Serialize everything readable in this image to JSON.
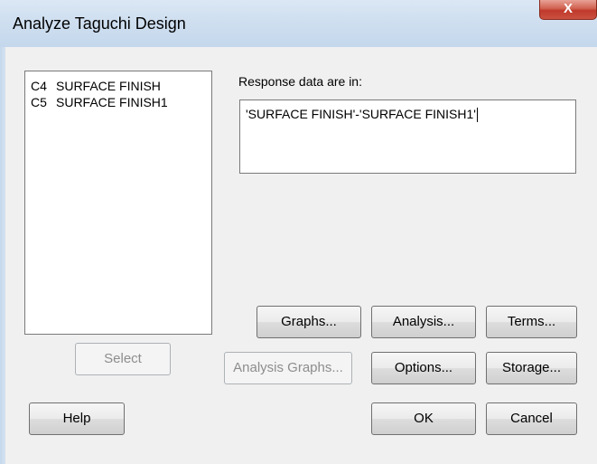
{
  "window": {
    "title": "Analyze Taguchi Design",
    "close_glyph": "X"
  },
  "variables_list": {
    "items": [
      {
        "column": "C4",
        "name": "SURFACE FINISH"
      },
      {
        "column": "C5",
        "name": "SURFACE FINISH1"
      }
    ]
  },
  "response": {
    "label": "Response data are in:",
    "value": "'SURFACE FINISH'-'SURFACE FINISH1'"
  },
  "buttons": {
    "graphs": "Graphs...",
    "analysis": "Analysis...",
    "terms": "Terms...",
    "select": "Select",
    "analysis_graphs": "Analysis Graphs...",
    "options": "Options...",
    "storage": "Storage...",
    "help": "Help",
    "ok": "OK",
    "cancel": "Cancel"
  }
}
